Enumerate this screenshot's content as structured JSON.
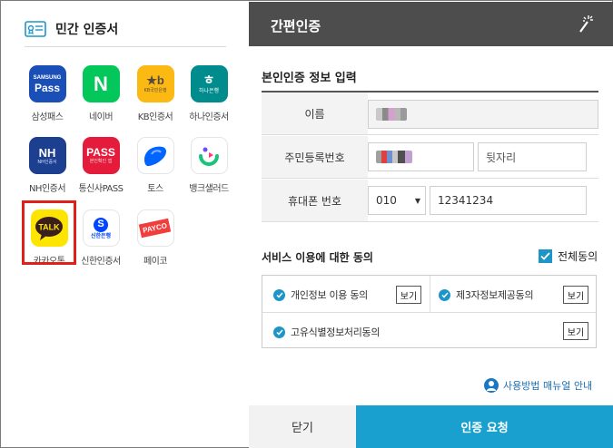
{
  "left": {
    "title": "민간 인증서",
    "apps": [
      {
        "name": "samsung-pass",
        "label": "삼성패스",
        "icon_text": "SAMSUNG\nPass",
        "color": "#1a4fb8"
      },
      {
        "name": "naver",
        "label": "네이버",
        "icon_text": "N",
        "color": "#03c75a"
      },
      {
        "name": "kb",
        "label": "KB인증서",
        "icon_text": "KB국민은행",
        "color": "#fdb913"
      },
      {
        "name": "hana",
        "label": "하나인증서",
        "icon_text": "하나은행",
        "color": "#008c8c"
      },
      {
        "name": "nh",
        "label": "NH인증서",
        "icon_text": "NH",
        "color": "#1d3f8f"
      },
      {
        "name": "pass",
        "label": "통신사PASS",
        "icon_text": "PASS",
        "color": "#e41b3a"
      },
      {
        "name": "toss",
        "label": "토스",
        "icon_text": "",
        "color": "#0064ff"
      },
      {
        "name": "bankaled",
        "label": "뱅크샐러드",
        "icon_text": "",
        "color": "#ffffff"
      },
      {
        "name": "kakao",
        "label": "카카오톡",
        "icon_text": "TALK",
        "color": "#fee500"
      },
      {
        "name": "shinhan",
        "label": "신한인증서",
        "icon_text": "신한은행",
        "color": "#ffffff"
      },
      {
        "name": "payco",
        "label": "페이코",
        "icon_text": "PAYCO",
        "color": "#ffffff"
      }
    ]
  },
  "right": {
    "title": "간편인증",
    "section_title": "본인인증 정보 입력",
    "name_label": "이름",
    "rrn_label": "주민등록번호",
    "rrn_back_placeholder": "뒷자리",
    "phone_label": "휴대폰 번호",
    "carrier_value": "010",
    "phone_value": "12341234",
    "consent_title": "서비스 이용에 대한 동의",
    "all_agree": "전체동의",
    "consent_items": [
      {
        "label": "개인정보 이용 동의",
        "view": "보기"
      },
      {
        "label": "제3자정보제공동의",
        "view": "보기"
      },
      {
        "label": "고유식별정보처리동의",
        "view": "보기"
      }
    ],
    "manual_link": "사용방법 매뉴얼 안내",
    "close_button": "닫기",
    "confirm_button": "인증 요청"
  }
}
